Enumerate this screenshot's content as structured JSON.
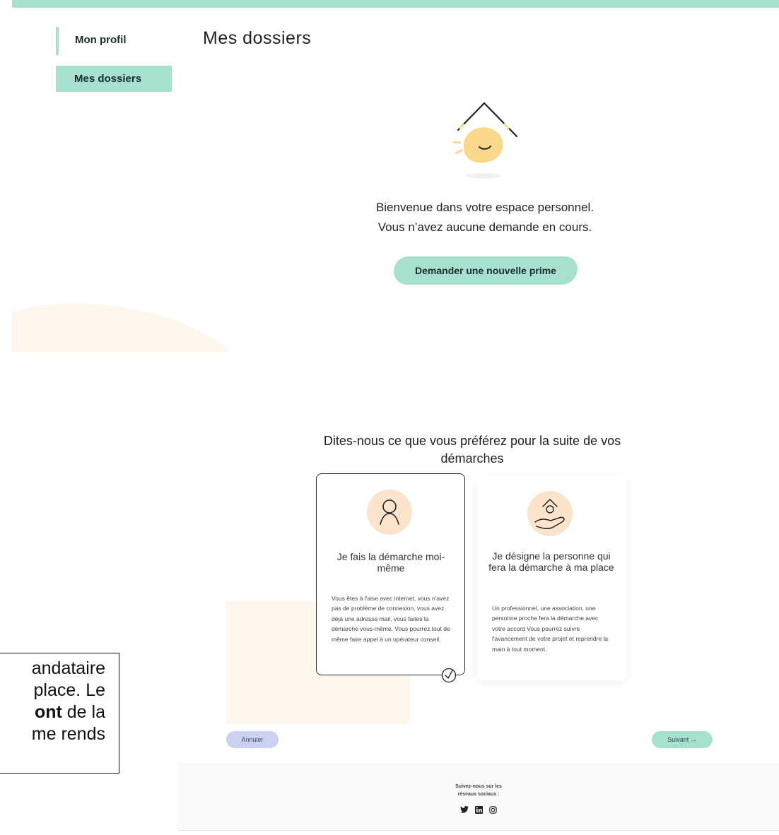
{
  "nav": {
    "profile_label": "Mon profil",
    "dossiers_label": "Mes dossiers"
  },
  "page": {
    "title": "Mes dossiers"
  },
  "welcome": {
    "line1": "Bienvenue dans votre espace personnel.",
    "line2": "Vous n’avez aucune demande en cours.",
    "button_label": "Demander une nouvelle prime"
  },
  "preference": {
    "title": "Dites-nous ce que vous préférez pour la suite de vos démarches",
    "cards": [
      {
        "title": "Je fais la démarche moi-même",
        "description": "Vous êtes à l'aise avec internet, vous n'avez pas de problème de connexion, vous avez déjà une adresse mail, vous faites la démarche vous-même. Vous pourrez tout de même faire appel à un opérateur conseil.",
        "selected": true,
        "icon": "person-icon"
      },
      {
        "title": "Je désigne la personne qui fera la démarche à ma place",
        "description": "Un professionnel, une association, une personne proche fera la démarche avec votre accord Vous pourrez suivre l'avancement de votre projet et reprendre la main à tout moment.",
        "selected": false,
        "icon": "hand-house-icon"
      }
    ],
    "cancel_label": "Annuler",
    "next_label": "Suivant →"
  },
  "footer": {
    "social_line1": "Suivez-nous sur les",
    "social_line2": "réseaux sociaux :",
    "social_icons": [
      "twitter-icon",
      "linkedin-icon",
      "instagram-icon"
    ]
  },
  "overlay": {
    "line1": "andataire",
    "line2": "place. Le",
    "line3_bold": "ont",
    "line3_rest": " de la",
    "line4": "me rends"
  },
  "colors": {
    "accent": "#a8e0d0",
    "cancel": "#c9d2ef",
    "sun": "#fbd98c",
    "peach": "#fbe3cc"
  }
}
